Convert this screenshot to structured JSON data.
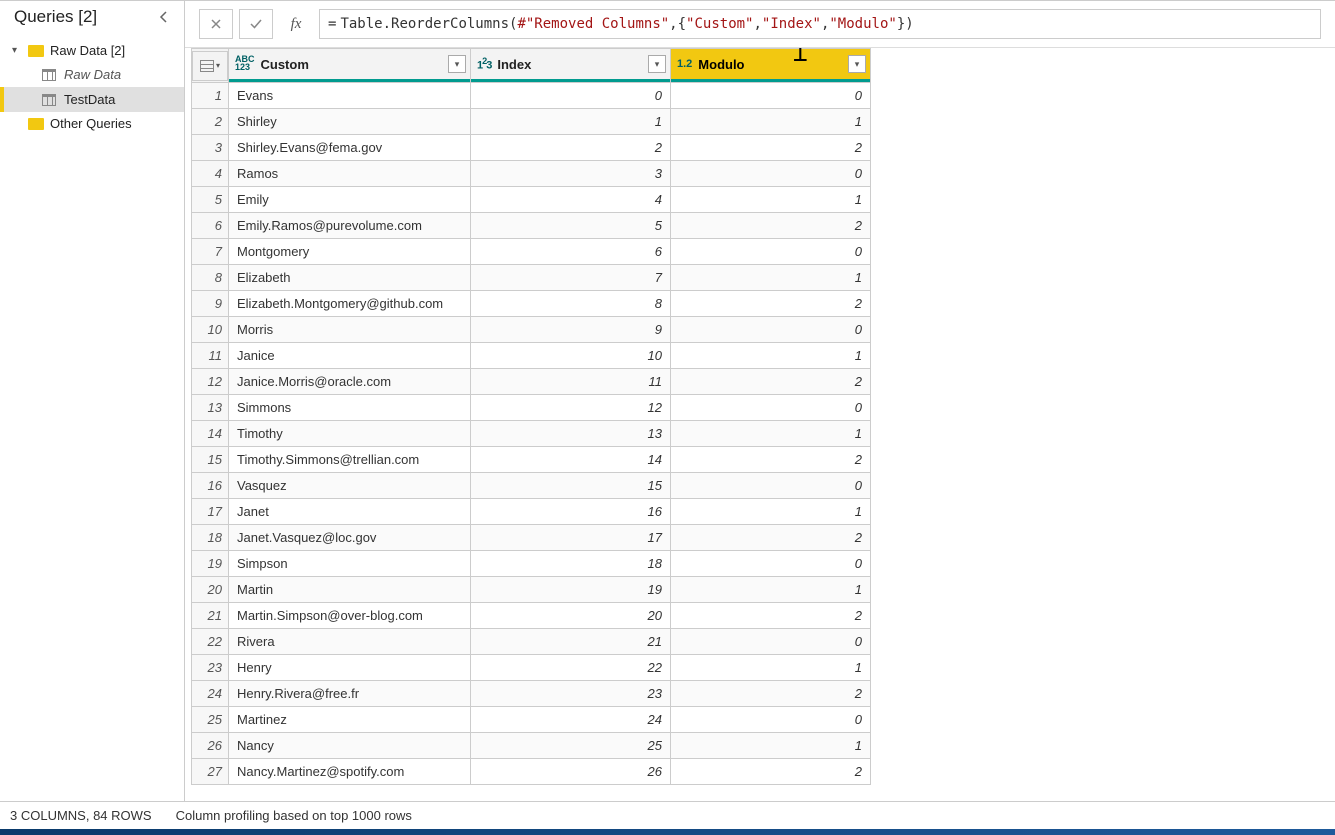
{
  "sidebar": {
    "title": "Queries [2]",
    "groups": [
      {
        "label": "Raw Data [2]",
        "expanded": true,
        "children": [
          {
            "label": "Raw Data",
            "italic": true,
            "selected": false
          },
          {
            "label": "TestData",
            "italic": false,
            "selected": true
          }
        ]
      },
      {
        "label": "Other Queries",
        "expanded": false,
        "children": []
      }
    ]
  },
  "formula": {
    "prefix": "=",
    "fn1": "Table.ReorderColumns",
    "arg1": "#\"Removed Columns\"",
    "list": [
      "\"Custom\"",
      "\"Index\"",
      "\"Modulo\""
    ]
  },
  "columns": [
    {
      "name": "Custom",
      "type": "ABC123",
      "selected": false
    },
    {
      "name": "Index",
      "type": "123",
      "selected": false
    },
    {
      "name": "Modulo",
      "type": "1.2",
      "selected": true
    }
  ],
  "rows": [
    {
      "n": 1,
      "custom": "Evans",
      "index": 0,
      "modulo": 0
    },
    {
      "n": 2,
      "custom": "Shirley",
      "index": 1,
      "modulo": 1
    },
    {
      "n": 3,
      "custom": "Shirley.Evans@fema.gov",
      "index": 2,
      "modulo": 2
    },
    {
      "n": 4,
      "custom": "Ramos",
      "index": 3,
      "modulo": 0
    },
    {
      "n": 5,
      "custom": "Emily",
      "index": 4,
      "modulo": 1
    },
    {
      "n": 6,
      "custom": "Emily.Ramos@purevolume.com",
      "index": 5,
      "modulo": 2
    },
    {
      "n": 7,
      "custom": "Montgomery",
      "index": 6,
      "modulo": 0
    },
    {
      "n": 8,
      "custom": "Elizabeth",
      "index": 7,
      "modulo": 1
    },
    {
      "n": 9,
      "custom": "Elizabeth.Montgomery@github.com",
      "index": 8,
      "modulo": 2
    },
    {
      "n": 10,
      "custom": "Morris",
      "index": 9,
      "modulo": 0
    },
    {
      "n": 11,
      "custom": "Janice",
      "index": 10,
      "modulo": 1
    },
    {
      "n": 12,
      "custom": "Janice.Morris@oracle.com",
      "index": 11,
      "modulo": 2
    },
    {
      "n": 13,
      "custom": "Simmons",
      "index": 12,
      "modulo": 0
    },
    {
      "n": 14,
      "custom": "Timothy",
      "index": 13,
      "modulo": 1
    },
    {
      "n": 15,
      "custom": "Timothy.Simmons@trellian.com",
      "index": 14,
      "modulo": 2
    },
    {
      "n": 16,
      "custom": "Vasquez",
      "index": 15,
      "modulo": 0
    },
    {
      "n": 17,
      "custom": "Janet",
      "index": 16,
      "modulo": 1
    },
    {
      "n": 18,
      "custom": "Janet.Vasquez@loc.gov",
      "index": 17,
      "modulo": 2
    },
    {
      "n": 19,
      "custom": "Simpson",
      "index": 18,
      "modulo": 0
    },
    {
      "n": 20,
      "custom": "Martin",
      "index": 19,
      "modulo": 1
    },
    {
      "n": 21,
      "custom": "Martin.Simpson@over-blog.com",
      "index": 20,
      "modulo": 2
    },
    {
      "n": 22,
      "custom": "Rivera",
      "index": 21,
      "modulo": 0
    },
    {
      "n": 23,
      "custom": "Henry",
      "index": 22,
      "modulo": 1
    },
    {
      "n": 24,
      "custom": "Henry.Rivera@free.fr",
      "index": 23,
      "modulo": 2
    },
    {
      "n": 25,
      "custom": "Martinez",
      "index": 24,
      "modulo": 0
    },
    {
      "n": 26,
      "custom": "Nancy",
      "index": 25,
      "modulo": 1
    },
    {
      "n": 27,
      "custom": "Nancy.Martinez@spotify.com",
      "index": 26,
      "modulo": 2
    }
  ],
  "status": {
    "summary": "3 COLUMNS, 84 ROWS",
    "profiling": "Column profiling based on top 1000 rows"
  }
}
